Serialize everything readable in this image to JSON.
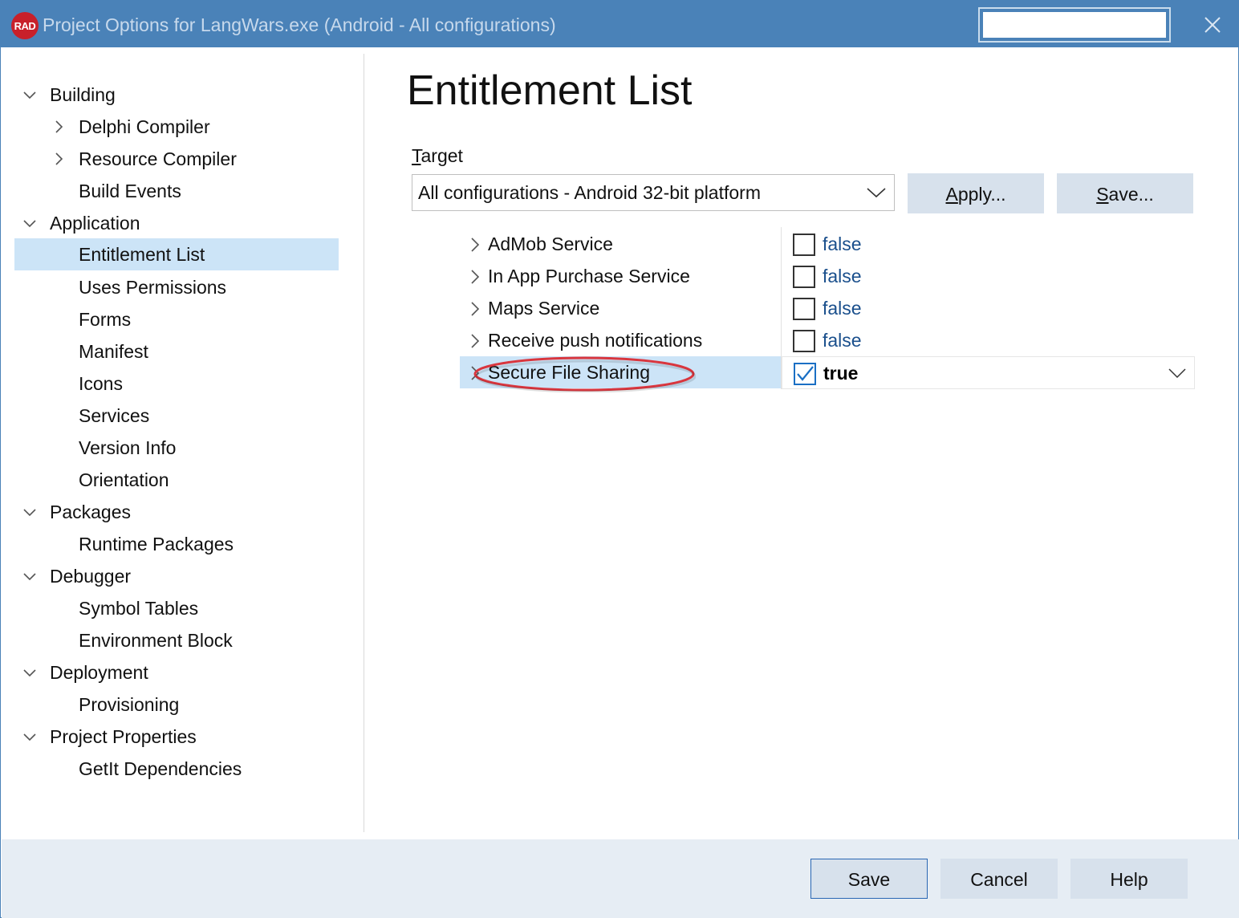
{
  "window": {
    "logo_text": "RAD",
    "title": "Project Options for LangWars.exe  (Android - All configurations)",
    "search_value": "",
    "accent": "#4a82b8"
  },
  "tree": {
    "items": [
      {
        "label": "Building",
        "expander": "chevron-down-icon"
      },
      {
        "label": "Delphi Compiler",
        "expander": "chevron-right-icon"
      },
      {
        "label": "Resource Compiler",
        "expander": "chevron-right-icon"
      },
      {
        "label": "Build Events"
      },
      {
        "label": "Application",
        "expander": "chevron-down-icon"
      },
      {
        "label": "Entitlement List",
        "selected": true
      },
      {
        "label": "Uses Permissions"
      },
      {
        "label": "Forms"
      },
      {
        "label": "Manifest"
      },
      {
        "label": "Icons"
      },
      {
        "label": "Services"
      },
      {
        "label": "Version Info"
      },
      {
        "label": "Orientation"
      },
      {
        "label": "Packages",
        "expander": "chevron-down-icon"
      },
      {
        "label": "Runtime Packages"
      },
      {
        "label": "Debugger",
        "expander": "chevron-down-icon"
      },
      {
        "label": "Symbol Tables"
      },
      {
        "label": "Environment Block"
      },
      {
        "label": "Deployment",
        "expander": "chevron-down-icon"
      },
      {
        "label": "Provisioning"
      },
      {
        "label": "Project Properties",
        "expander": "chevron-down-icon"
      },
      {
        "label": "GetIt Dependencies"
      }
    ]
  },
  "main": {
    "heading": "Entitlement List",
    "target_label_accel": "T",
    "target_label_rest": "arget",
    "target_value": "All configurations - Android 32-bit platform",
    "apply_accel": "A",
    "apply_rest": "pply...",
    "save_accel": "S",
    "save_rest": "ave...",
    "entitlements": [
      {
        "name": "AdMob Service",
        "value": "false",
        "checked": false
      },
      {
        "name": "In App Purchase Service",
        "value": "false",
        "checked": false
      },
      {
        "name": "Maps Service",
        "value": "false",
        "checked": false
      },
      {
        "name": "Receive push notifications",
        "value": "false",
        "checked": false
      },
      {
        "name": "Secure File Sharing",
        "value": "true",
        "checked": true,
        "selected": true
      }
    ],
    "highlight_color": "#d9363e"
  },
  "footer": {
    "save": "Save",
    "cancel": "Cancel",
    "help": "Help"
  }
}
